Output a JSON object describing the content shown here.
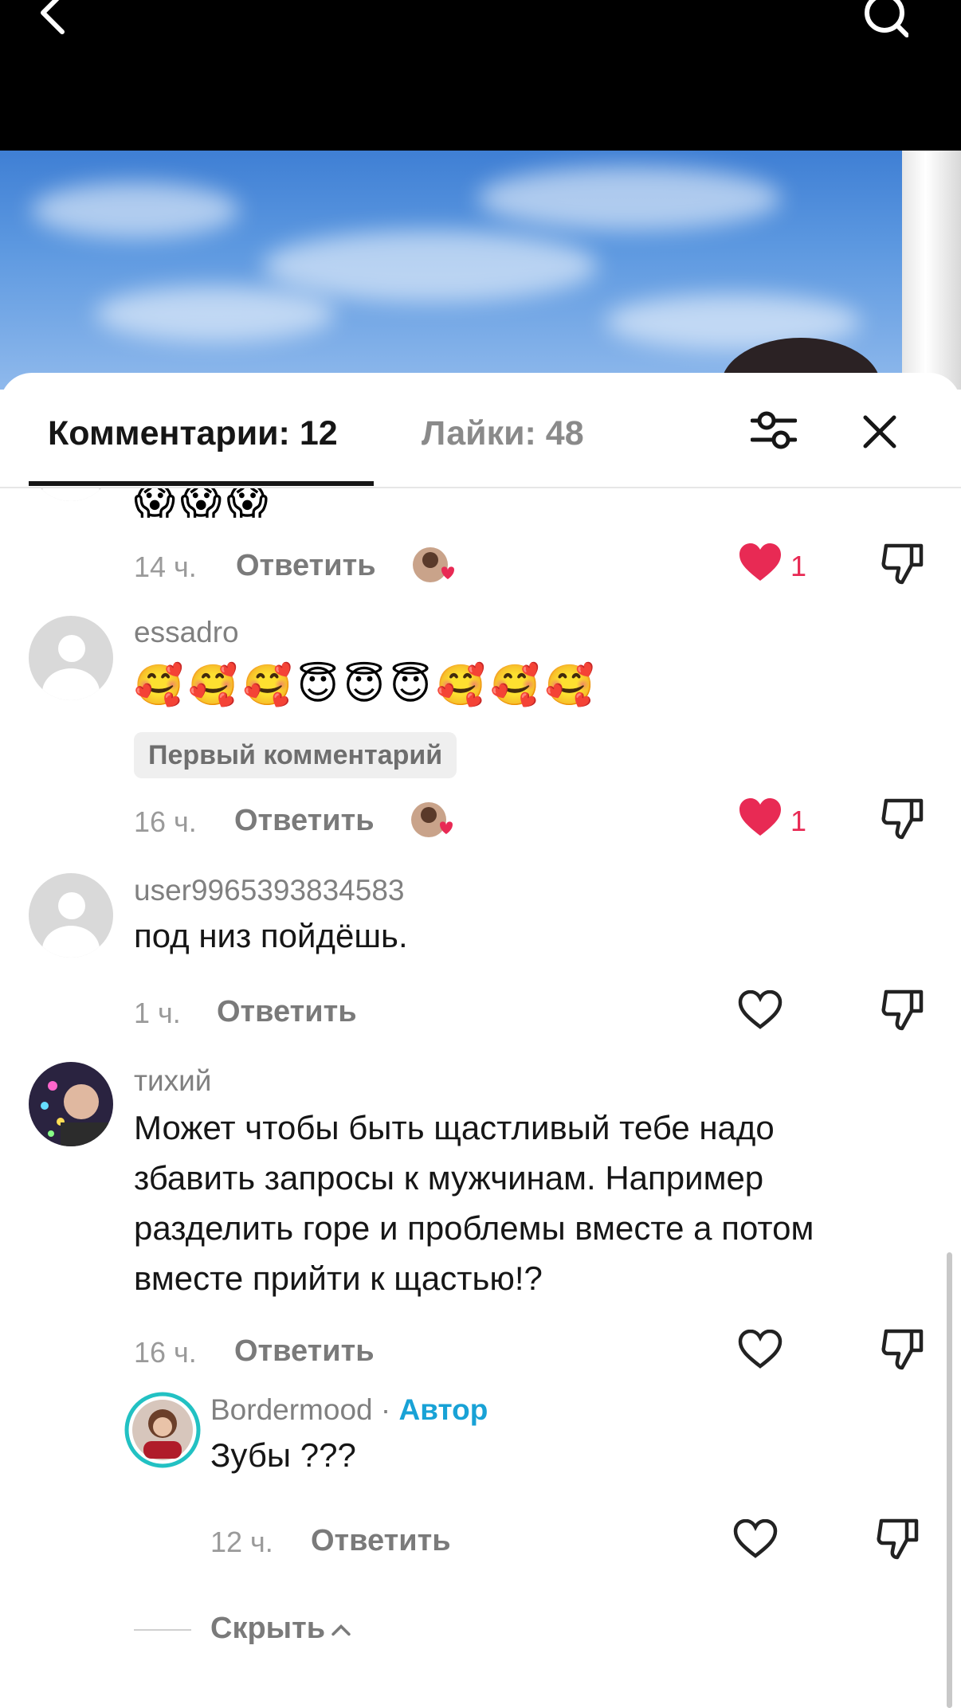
{
  "tabs": {
    "comments_label": "Комментарии: 12",
    "likes_label": "Лайки: 48"
  },
  "comments": [
    {
      "text": "😱😱😱",
      "time": "14 ч.",
      "reply_label": "Ответить",
      "likes": "1",
      "liked_by_author": true
    },
    {
      "username": "essadro",
      "text": "🥰🥰🥰😇😇😇🥰🥰🥰",
      "badge": "Первый комментарий",
      "time": "16 ч.",
      "reply_label": "Ответить",
      "likes": "1",
      "liked_by_author": true
    },
    {
      "username": "user9965393834583",
      "text": "под низ пойдёшь.",
      "time": "1 ч.",
      "reply_label": "Ответить"
    },
    {
      "username": "тихий",
      "lines": [
        "Может чтобы быть щастливый тебе надо",
        "збавить запросы к мужчинам. Например",
        "разделить горе и проблемы вместе а потом",
        "вместе прийти к щастью!?"
      ],
      "time": "16 ч.",
      "reply_label": "Ответить",
      "reply": {
        "username": "Bordermood",
        "separator": " · ",
        "author_tag": "Автор",
        "text": "Зубы ???",
        "time": "12 ч.",
        "reply_label": "Ответить"
      }
    }
  ],
  "hide_label": "Скрыть",
  "colors": {
    "like_red": "#e82a54",
    "author_blue": "#18a2d6",
    "text_dark": "#161616",
    "text_gray": "#7a7a7a"
  },
  "icons": [
    "back-icon",
    "search-icon",
    "filter-icon",
    "close-icon",
    "heart-icon",
    "heart-outline-icon",
    "dislike-icon",
    "chevron-up-icon"
  ]
}
